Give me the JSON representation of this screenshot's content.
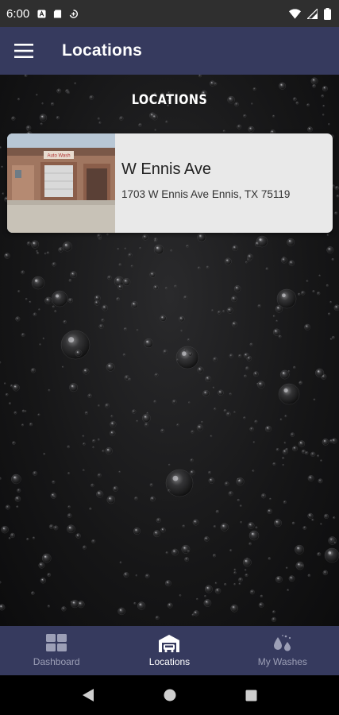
{
  "status_bar": {
    "time": "6:00",
    "left_icons": [
      "notification-a-icon",
      "sd-card-icon",
      "data-saver-icon"
    ],
    "right_icons": [
      "wifi-icon",
      "cell-signal-icon",
      "battery-icon"
    ]
  },
  "app_bar": {
    "title": "Locations",
    "menu_icon": "hamburger-menu-icon"
  },
  "main": {
    "section_title": "LOCATIONS",
    "locations": [
      {
        "name": "W Ennis Ave",
        "address": "1703 W Ennis Ave Ennis, TX 75119",
        "sign_text": "Auto Wash"
      }
    ]
  },
  "bottom_nav": {
    "items": [
      {
        "label": "Dashboard",
        "icon": "dashboard-grid-icon",
        "active": false
      },
      {
        "label": "Locations",
        "icon": "car-wash-building-icon",
        "active": true
      },
      {
        "label": "My Washes",
        "icon": "water-drops-icon",
        "active": false
      }
    ]
  },
  "system_nav": {
    "back": "back-triangle-icon",
    "home": "home-circle-icon",
    "recents": "recents-square-icon"
  },
  "colors": {
    "primary": "#363a5e",
    "status_bar": "#2f2f2f",
    "card_bg": "#e9e9e9",
    "inactive_nav": "#9c9fb6"
  }
}
